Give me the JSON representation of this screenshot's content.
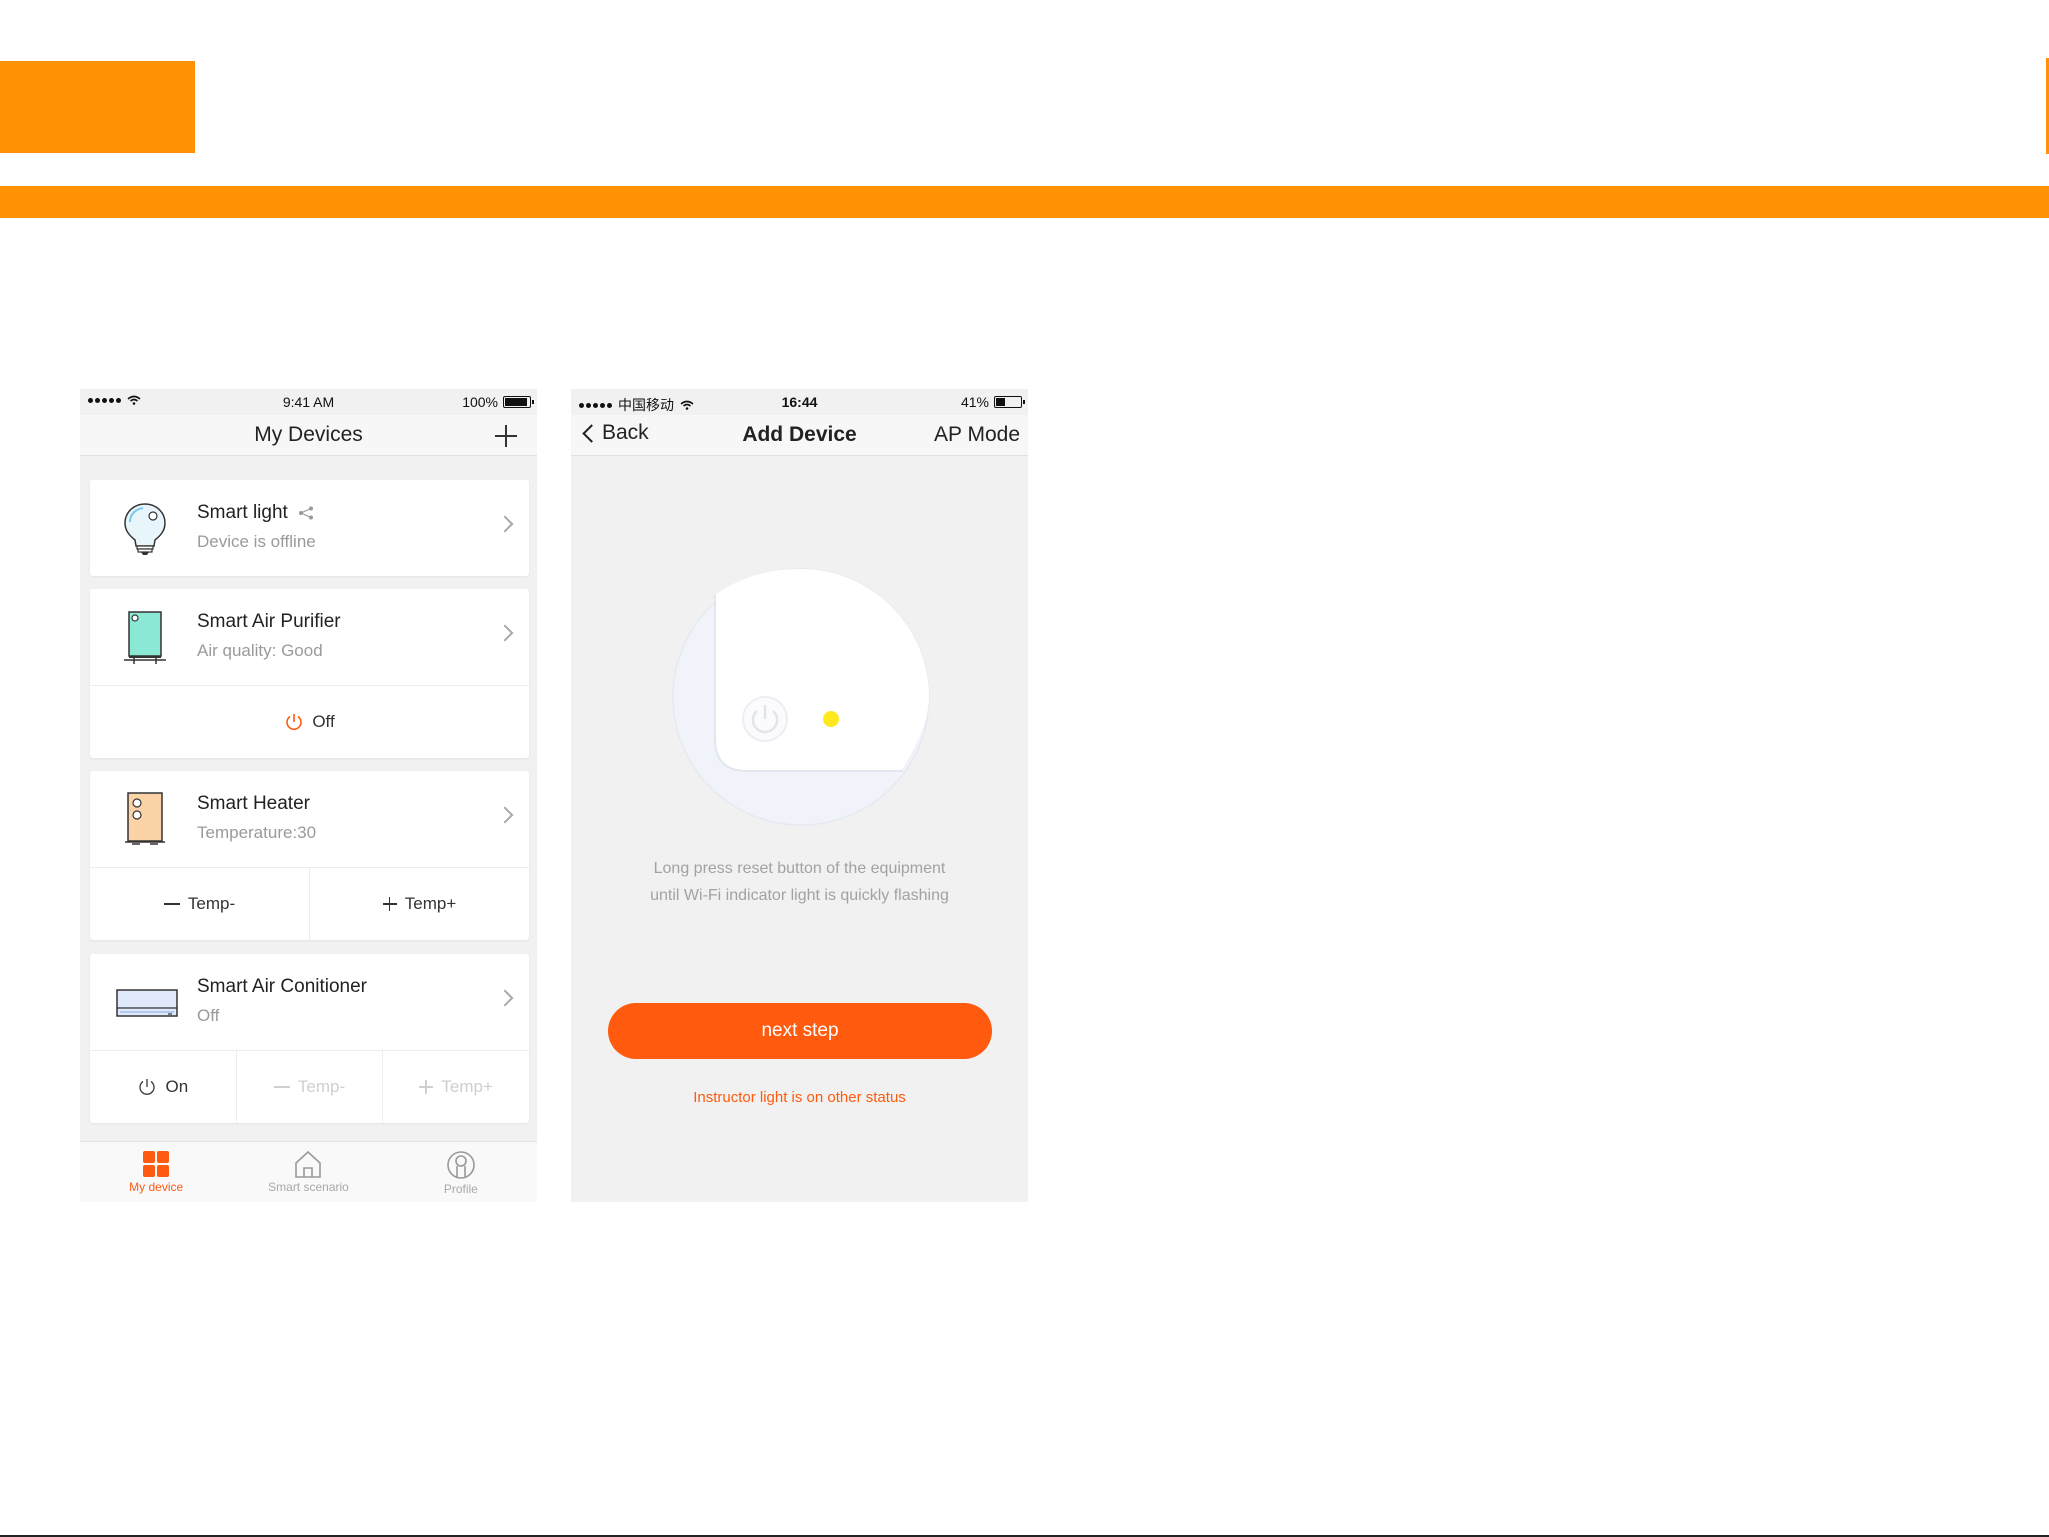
{
  "colors": {
    "brand_orange": "#ff9305",
    "accent": "#ff5a0d"
  },
  "phone1": {
    "status_bar": {
      "time": "9:41 AM",
      "battery": "100%",
      "battery_level": 1.0
    },
    "nav": {
      "title": "My Devices",
      "add_icon": "plus-icon"
    },
    "devices": [
      {
        "name": "Smart light",
        "status": "Device is offline",
        "icon": "bulb-icon",
        "share_icon": "share-icon"
      },
      {
        "name": "Smart Air Purifier",
        "status": "Air quality: Good",
        "icon": "air-purifier-icon",
        "actions": [
          "Off"
        ]
      },
      {
        "name": "Smart Heater",
        "status": "Temperature:30",
        "icon": "heater-icon",
        "actions": [
          "Temp-",
          "Temp+"
        ]
      },
      {
        "name": "Smart Air Conitioner",
        "status": "Off",
        "icon": "air-conditioner-icon",
        "actions": [
          "On",
          "Temp-",
          "Temp+"
        ]
      }
    ],
    "tabs": [
      {
        "label": "My device",
        "icon": "grid-icon",
        "active": true
      },
      {
        "label": "Smart scenario",
        "icon": "home-icon",
        "active": false
      },
      {
        "label": "Profile",
        "icon": "profile-icon",
        "active": false
      }
    ]
  },
  "phone2": {
    "status_bar": {
      "carrier": "中国移动",
      "time": "16:44",
      "battery": "41%",
      "battery_level": 0.41
    },
    "nav": {
      "back": "Back",
      "title": "Add Device",
      "right": "AP Mode"
    },
    "instruction_line1": "Long press reset button of the equipment",
    "instruction_line2": "until Wi-Fi indicator light is quickly flashing",
    "next_button": "next step",
    "other_status_link": "Instructor light is on other status"
  }
}
